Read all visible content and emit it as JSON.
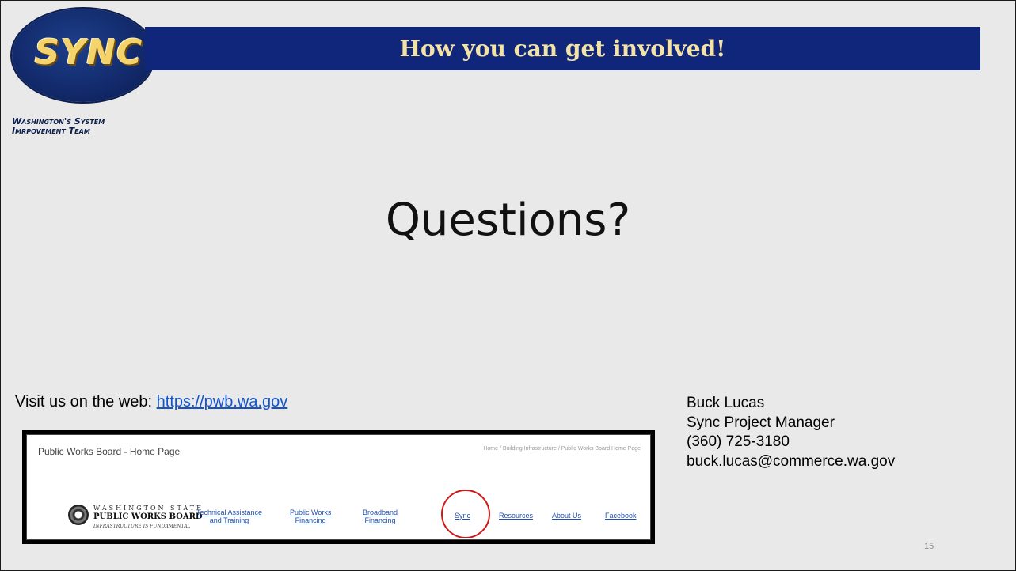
{
  "logo": {
    "word": "SYNC",
    "tag_line1": "Washington's System",
    "tag_line2": "Imrpovement Team"
  },
  "header": {
    "title": "How you can get involved!"
  },
  "main": {
    "questions": "Questions?"
  },
  "web": {
    "label": "Visit us on the web:",
    "url": "https://pwb.wa.gov"
  },
  "contact": {
    "name": "Buck Lucas",
    "role": "Sync Project Manager",
    "phone": "(360) 725-3180",
    "email": "buck.lucas@commerce.wa.gov"
  },
  "slide_number": "15",
  "website": {
    "page_title": "Public Works Board - Home Page",
    "breadcrumb": "Home / Building Infrastructure / Public Works Board Home Page",
    "logo_line1": "WASHINGTON STATE",
    "logo_line2": "PUBLIC WORKS BOARD",
    "logo_line3": "INFRASTRUCTURE IS FUNDAMENTAL",
    "nav": [
      "Technical Assistance\nand Training",
      "Public Works\nFinancing",
      "Broadband\nFinancing",
      "Sync",
      "Resources",
      "About Us",
      "Facebook"
    ]
  },
  "colors": {
    "title_bar": "#10267a",
    "title_text": "#f3e3a7",
    "logo_gold": "#f4d36a",
    "link": "#1155cc",
    "highlight_circle": "#d01818"
  }
}
